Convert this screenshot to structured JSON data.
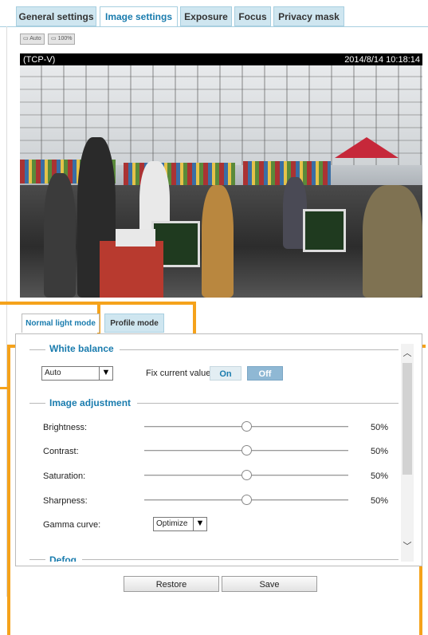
{
  "top_tabs": [
    {
      "label": "General settings"
    },
    {
      "label": "Image settings"
    },
    {
      "label": "Exposure"
    },
    {
      "label": "Focus"
    },
    {
      "label": "Privacy mask"
    }
  ],
  "zoom": {
    "auto_label": "Auto",
    "percent_label": "100%"
  },
  "video": {
    "stream_label": "(TCP-V)",
    "timestamp": "2014/8/14 10:18:14"
  },
  "mode_tabs": [
    {
      "label": "Normal light mode"
    },
    {
      "label": "Profile mode"
    }
  ],
  "white_balance": {
    "heading": "White balance",
    "mode_value": "Auto",
    "fix_label": "Fix current value:",
    "on_label": "On",
    "off_label": "Off"
  },
  "image_adjustment": {
    "heading": "Image adjustment",
    "sliders": [
      {
        "label": "Brightness:",
        "value_text": "50%",
        "value": 0.5
      },
      {
        "label": "Contrast:",
        "value_text": "50%",
        "value": 0.5
      },
      {
        "label": "Saturation:",
        "value_text": "50%",
        "value": 0.5
      },
      {
        "label": "Sharpness:",
        "value_text": "50%",
        "value": 0.5
      }
    ],
    "gamma_label": "Gamma curve:",
    "gamma_value": "Optimize"
  },
  "defog": {
    "heading": "Defog"
  },
  "buttons": {
    "restore": "Restore",
    "save": "Save"
  },
  "colors": {
    "accent": "#1a7cae",
    "highlight": "#f5a21b",
    "tab_bg": "#cfe6f0"
  }
}
